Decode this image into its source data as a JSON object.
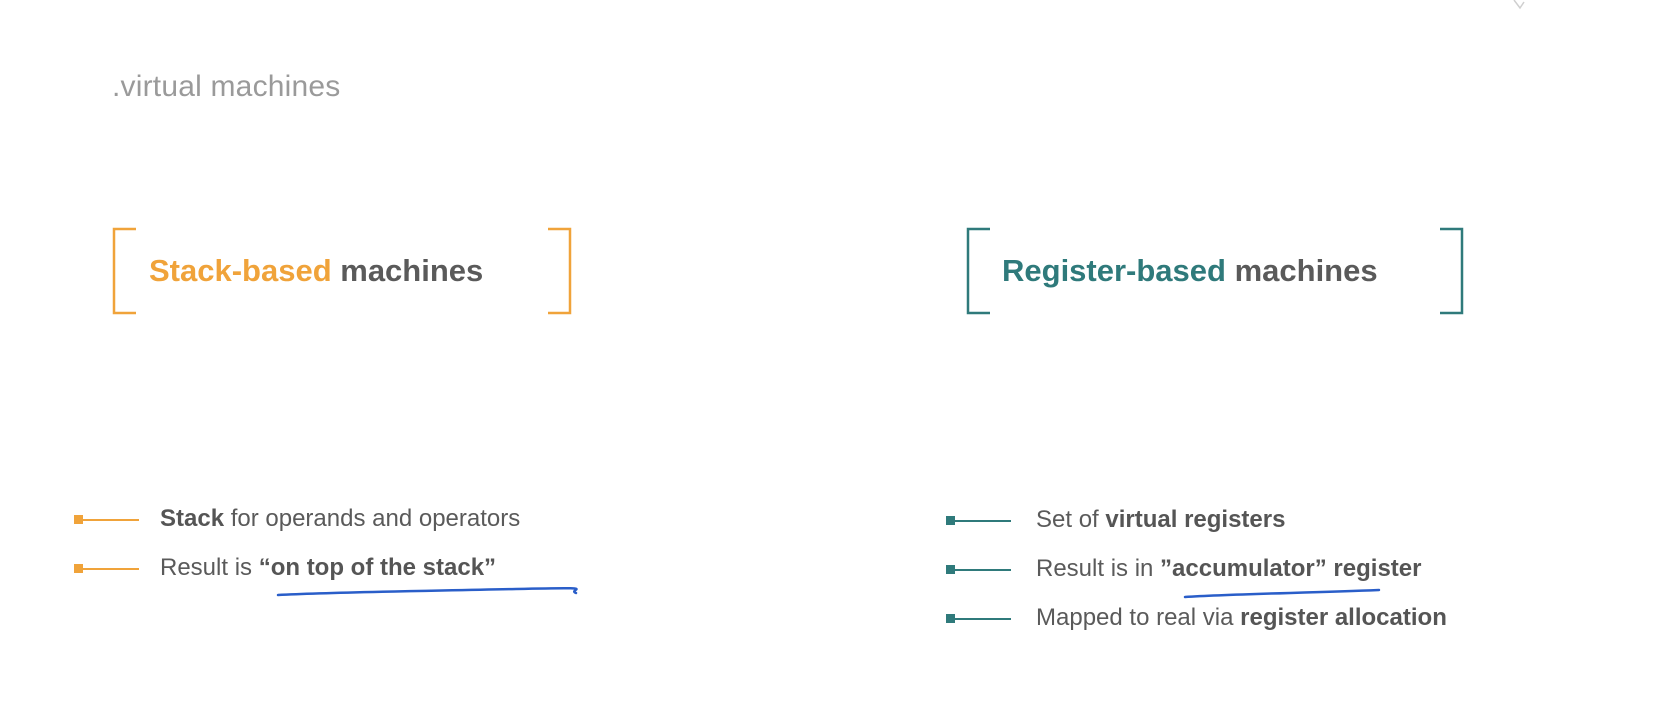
{
  "slide": {
    "title": ".virtual machines"
  },
  "colors": {
    "orange": "#f0a33a",
    "teal": "#2f7a7b",
    "pen_blue": "#2a5ec9",
    "text": "#5a5a5a",
    "title": "#9a9a9a"
  },
  "left": {
    "heading_accent": "Stack-based",
    "heading_rest": " machines",
    "bullets": [
      {
        "bold": "Stack",
        "text": " for operands and operators"
      },
      {
        "prefix": "Result is ",
        "bold": "“on top of the stack”"
      }
    ]
  },
  "right": {
    "heading_accent": "Register-based",
    "heading_rest": " machines",
    "bullets": [
      {
        "prefix": "Set of ",
        "bold": "virtual registers"
      },
      {
        "prefix": "Result is in ",
        "bold": "”accumulator”",
        "suffix": " register"
      },
      {
        "prefix": "Mapped to real via ",
        "bold": "register allocation"
      }
    ]
  }
}
